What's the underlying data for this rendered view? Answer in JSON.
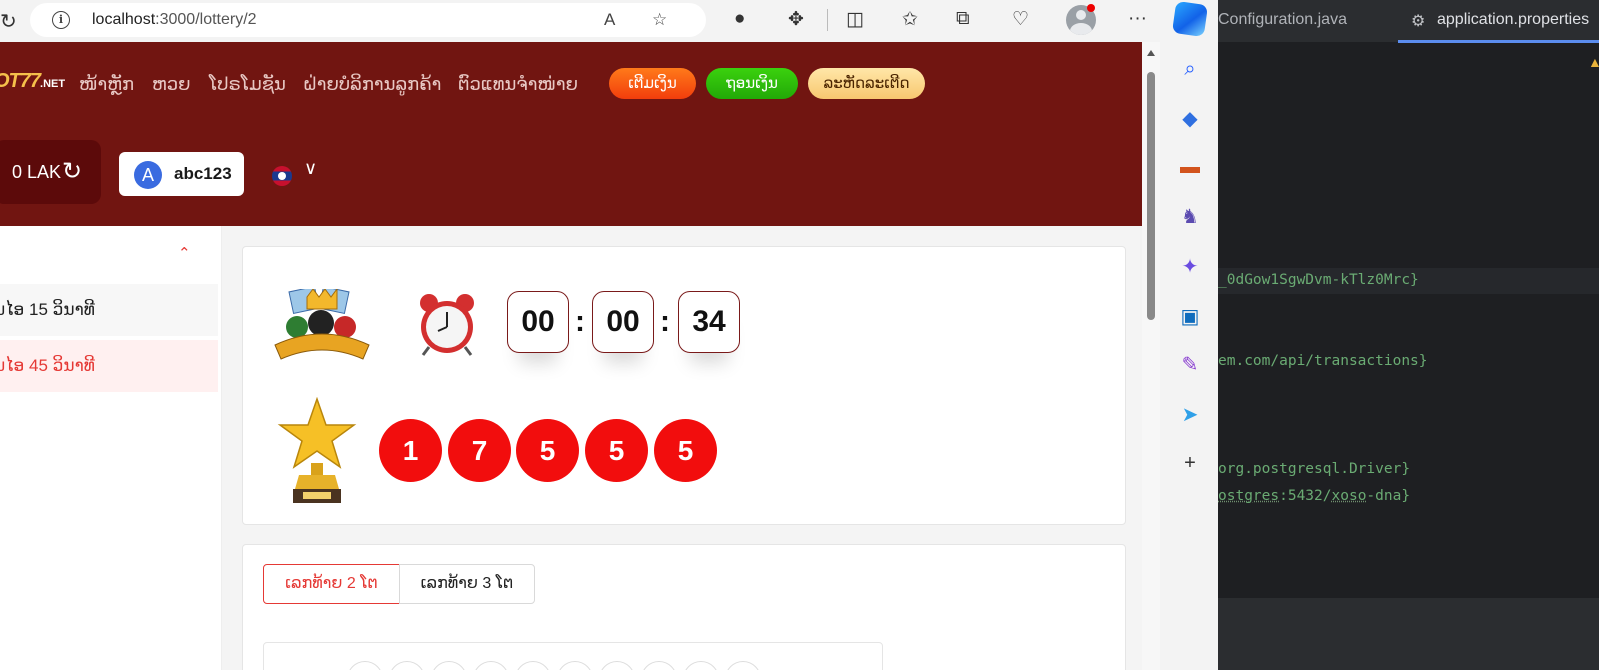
{
  "browser": {
    "url_host": "localhost",
    "url_rest": ":3000/lottery/2"
  },
  "site": {
    "logo_main": "OT77",
    "logo_suffix": ".NET",
    "nav": [
      "ໜ້າຫຼັກ",
      "ຫວຍ",
      "ໂປຣໂມຊັນ",
      "ຝ່າຍບໍລິການລູກຄ້າ",
      "ຕົວແທນຈຳໜ່າຍ"
    ],
    "buttons": {
      "deposit": "ເຕີມເງິນ",
      "withdraw": "ຖອນເງິນ",
      "invite_code": "ລະຫັດລະເຕີດ"
    },
    "balance": "0 LAK",
    "user": {
      "initial": "A",
      "name": "abc123"
    }
  },
  "sidebar": {
    "items": [
      {
        "label": "ນໄອ 15 ວິນາທີ"
      },
      {
        "label": "ນໄອ 45 ວິນາທີ"
      }
    ]
  },
  "draw": {
    "countdown": {
      "h": "00",
      "m": "00",
      "s": "34"
    },
    "separator": ":",
    "balls": [
      "1",
      "7",
      "5",
      "5",
      "5"
    ]
  },
  "bet_tabs": [
    "ເລກທ້າຍ 2 ໂຕ",
    "ເລກທ້າຍ 3 ໂຕ"
  ],
  "ide": {
    "tab_inactive": "Configuration.java",
    "tab_active": "application.properties",
    "lines": [
      {
        "text": "_0dGow1SgwDvm-kTlz0Mrc}"
      },
      {
        "text": "em.com/api/transactions}"
      },
      {
        "text": "org.postgresql.Driver}"
      },
      {
        "pre": "ostgres",
        "mid": ":5432/",
        "u": "xoso",
        "post": "-dna}"
      }
    ]
  },
  "colors": {
    "header_bg": "#711511",
    "accent_red": "#f20d0d",
    "deposit": "#f23d0c",
    "withdraw": "#22a907",
    "code_string": "#6aab73"
  }
}
